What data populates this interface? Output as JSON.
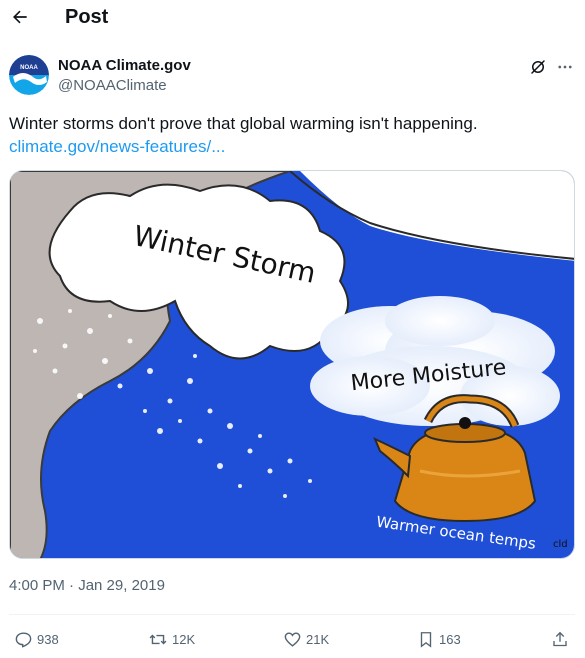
{
  "header": {
    "title": "Post",
    "back_icon": "arrow-left-icon"
  },
  "author": {
    "name": "NOAA Climate.gov",
    "handle": "@NOAAClimate",
    "avatar_text": "NOAA",
    "avatar_colors": {
      "top": "#1f3f93",
      "bottom": "#12a6e8",
      "bird": "#ffffff"
    }
  },
  "post": {
    "text": "Winter storms don't prove that global warming isn't happening.",
    "link": "climate.gov/news-features/...",
    "timestamp": "4:00 PM · Jan 29, 2019"
  },
  "media": {
    "cloud_label": "Winter Storm",
    "steam_label": "More Moisture",
    "ocean_label": "Warmer ocean temps",
    "signature": "cld",
    "colors": {
      "ocean": "#1f4fd6",
      "land": "#bdb6b3",
      "kettle": "#d98616",
      "cloud": "#ffffff"
    }
  },
  "actions": {
    "replies": "938",
    "reposts": "12K",
    "likes": "21K",
    "bookmarks": "163"
  },
  "colors": {
    "link": "#1d9bf0",
    "muted": "#536471",
    "text": "#0f1419"
  }
}
